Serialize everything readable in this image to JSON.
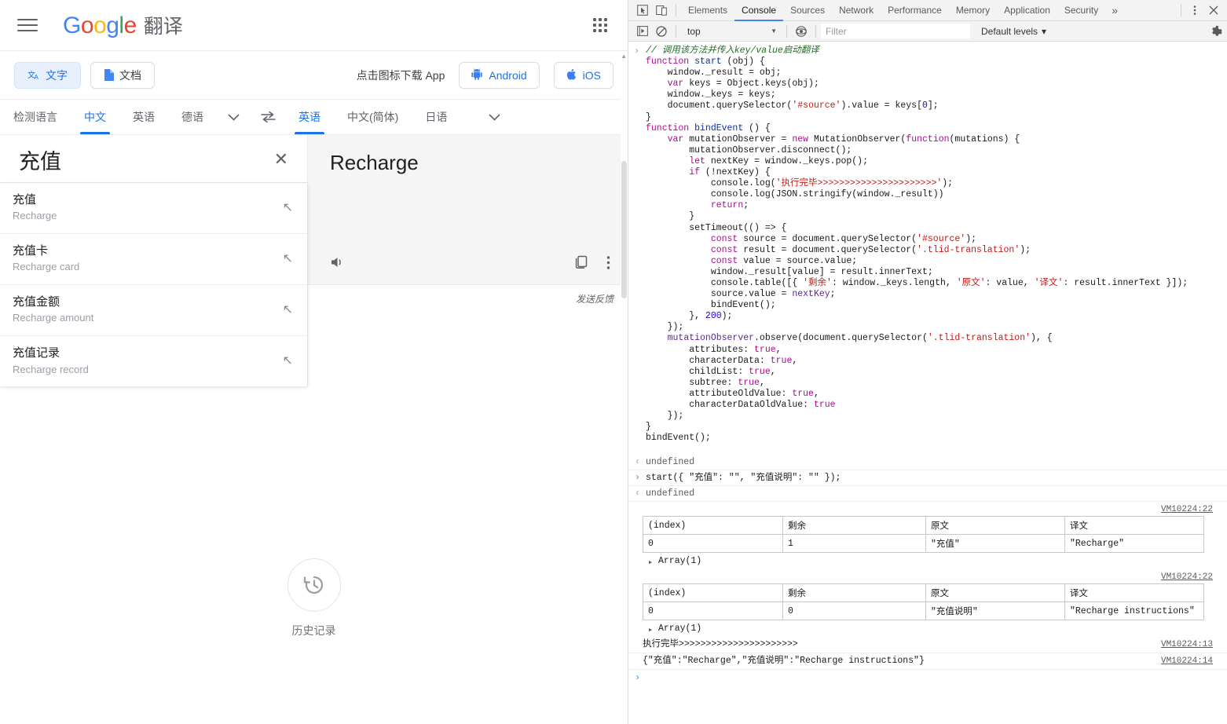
{
  "translate": {
    "header": {
      "menu_icon": "hamburger-menu-icon",
      "logo_g1": "G",
      "logo_o1": "o",
      "logo_o2": "o",
      "logo_g2": "g",
      "logo_l": "l",
      "logo_e": "e",
      "product_name": "翻译",
      "apps_icon": "apps-grid-icon"
    },
    "toolbar": {
      "text_tab": "文字",
      "doc_tab": "文档",
      "download_prompt": "点击图标下载 App",
      "android_label": "Android",
      "ios_label": "iOS"
    },
    "source_languages": {
      "detect": "检测语言",
      "items": [
        "中文",
        "英语",
        "德语"
      ],
      "selected": "中文",
      "more_icon": "chevron-down-icon"
    },
    "swap_icon": "swap-languages-icon",
    "target_languages": {
      "items": [
        "英语",
        "中文(简体)",
        "日语"
      ],
      "selected": "英语",
      "more_icon": "chevron-down-icon"
    },
    "source_text": "充值",
    "clear_label": "✕",
    "translated_text": "Recharge",
    "listen_icon": "speaker-icon",
    "copy_icon": "copy-icon",
    "more_icon": "more-vertical-icon",
    "feedback": "发送反馈",
    "suggestions": [
      {
        "zh": "充值",
        "en": "Recharge",
        "arrow": "↖"
      },
      {
        "zh": "充值卡",
        "en": "Recharge card",
        "arrow": "↖"
      },
      {
        "zh": "充值金额",
        "en": "Recharge amount",
        "arrow": "↖"
      },
      {
        "zh": "充值记录",
        "en": "Recharge record",
        "arrow": "↖"
      }
    ],
    "history": {
      "icon": "history-clock-icon",
      "label": "历史记录"
    }
  },
  "devtools": {
    "tabbar": {
      "inspect_icon": "inspect-element-icon",
      "device_icon": "device-toolbar-icon",
      "tabs": [
        "Elements",
        "Console",
        "Sources",
        "Network",
        "Performance",
        "Memory",
        "Application",
        "Security"
      ],
      "active_tab": "Console",
      "overflow_label": "»",
      "kebab_icon": "more-vertical-icon",
      "close_icon": "close-icon"
    },
    "filterbar": {
      "execute_icon": "sidebar-toggle-icon",
      "clear_icon": "clear-console-icon",
      "context": "top",
      "eye_icon": "live-expression-icon",
      "filter_placeholder": "Filter",
      "filter_value": "",
      "levels": "Default levels",
      "levels_caret": "▾",
      "settings_icon": "gear-icon"
    },
    "code": {
      "comment": "// 调用该方法并传入key/value启动翻译",
      "lines": [
        "function start (obj) {",
        "    window._result = obj;",
        "    var keys = Object.keys(obj);",
        "    window._keys = keys;",
        "    document.querySelector('#source').value = keys[0];",
        "}",
        "function bindEvent () {",
        "    var mutationObserver = new MutationObserver(function(mutations) {",
        "        mutationObserver.disconnect();",
        "        let nextKey = window._keys.pop();",
        "        if (!nextKey) {",
        "            console.log('执行完毕>>>>>>>>>>>>>>>>>>>>>>');",
        "            console.log(JSON.stringify(window._result))",
        "            return;",
        "        }",
        "        setTimeout(() => {",
        "            const source = document.querySelector('#source');",
        "            const result = document.querySelector('.tlid-translation');",
        "            const value = source.value;",
        "            window._result[value] = result.innerText;",
        "            console.table([{ '剩余': window._keys.length, '原文': value, '译文': result.innerText }]);",
        "            source.value = nextKey;",
        "            bindEvent();",
        "        }, 200);",
        "    });",
        "    mutationObserver.observe(document.querySelector('.tlid-translation'), {",
        "        attributes: true,",
        "        characterData: true,",
        "        childList: true,",
        "        subtree: true,",
        "        attributeOldValue: true,",
        "        characterDataOldValue: true",
        "    });",
        "}",
        "bindEvent();"
      ]
    },
    "output": {
      "result_1": "undefined",
      "input_1": "start({ \"充值\": \"\", \"充值说明\": \"\" });",
      "result_2": "undefined",
      "tables": [
        {
          "vm": "VM10224:22",
          "headers": [
            "(index)",
            "剩余",
            "原文",
            "译文"
          ],
          "row": [
            "0",
            "1",
            "\"充值\"",
            "\"Recharge\""
          ],
          "expand": "Array(1)"
        },
        {
          "vm": "VM10224:22",
          "headers": [
            "(index)",
            "剩余",
            "原文",
            "译文"
          ],
          "row": [
            "0",
            "0",
            "\"充值说明\"",
            "\"Recharge instructions\""
          ],
          "expand": "Array(1)"
        }
      ],
      "logs": [
        {
          "text": "执行完毕>>>>>>>>>>>>>>>>>>>>>>",
          "vm": "VM10224:13"
        },
        {
          "text": "{\"充值\":\"Recharge\",\"充值说明\":\"Recharge instructions\"}",
          "vm": "VM10224:14"
        }
      ]
    }
  },
  "colors": {
    "google_blue": "#4285f4",
    "google_red": "#ea4335",
    "google_yellow": "#fbbc05",
    "google_green": "#34a853",
    "link_blue": "#1a73e8",
    "console_string_red": "#c41a16",
    "console_keyword_purple": "#aa0d91",
    "console_number_blue": "#1c00cf",
    "console_comment_green": "#236e25"
  }
}
